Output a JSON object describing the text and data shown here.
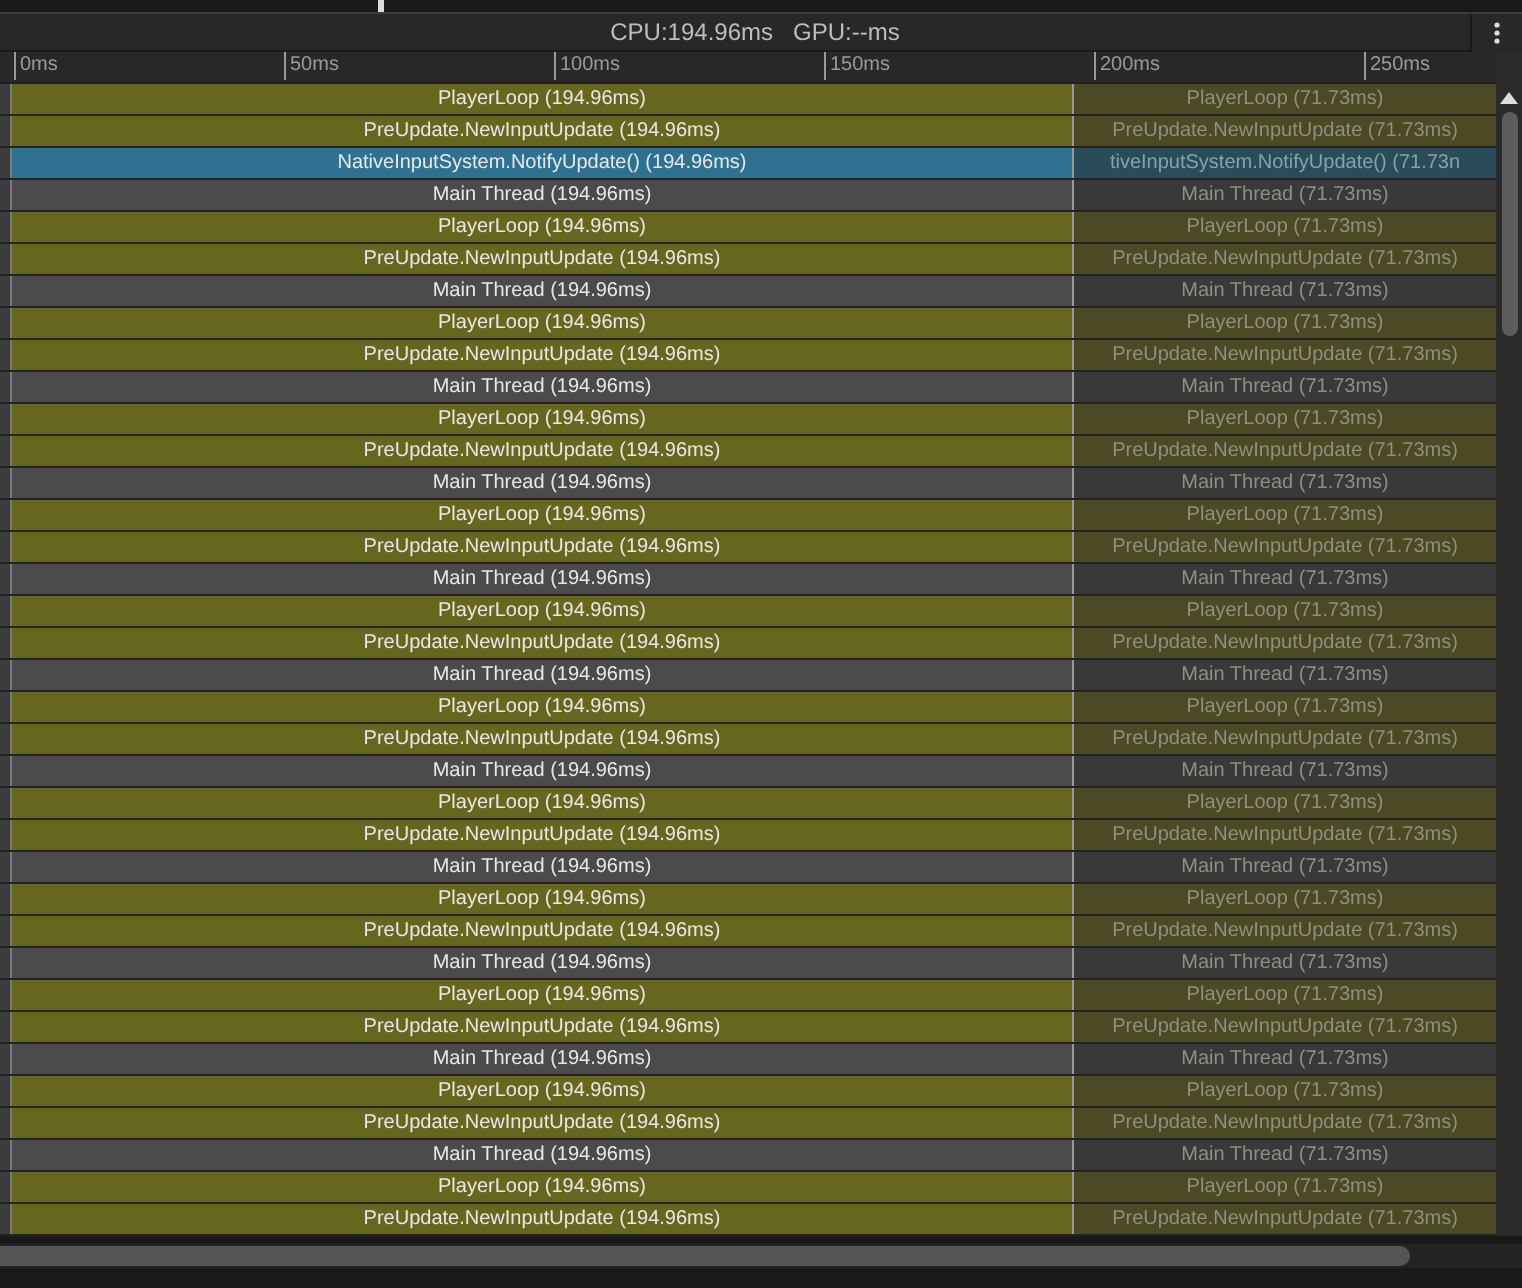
{
  "toolbar": {
    "stats": "CPU:194.96ms   GPU:--ms"
  },
  "ruler": {
    "ticks": [
      "0ms",
      "50ms",
      "100ms",
      "150ms",
      "200ms",
      "250ms"
    ]
  },
  "rows": [
    {
      "kind": "loop",
      "label": "PlayerLoop (194.96ms)",
      "next_label": "PlayerLoop (71.73ms)"
    },
    {
      "kind": "loop",
      "label": "PreUpdate.NewInputUpdate (194.96ms)",
      "next_label": "PreUpdate.NewInputUpdate (71.73ms)"
    },
    {
      "kind": "input",
      "label": "NativeInputSystem.NotifyUpdate() (194.96ms)",
      "next_label": "tiveInputSystem.NotifyUpdate() (71.73n"
    },
    {
      "kind": "thread",
      "label": "Main Thread (194.96ms)",
      "next_label": "Main Thread (71.73ms)"
    },
    {
      "kind": "loop",
      "label": "PlayerLoop (194.96ms)",
      "next_label": "PlayerLoop (71.73ms)"
    },
    {
      "kind": "loop",
      "label": "PreUpdate.NewInputUpdate (194.96ms)",
      "next_label": "PreUpdate.NewInputUpdate (71.73ms)"
    },
    {
      "kind": "thread",
      "label": "Main Thread (194.96ms)",
      "next_label": "Main Thread (71.73ms)"
    },
    {
      "kind": "loop",
      "label": "PlayerLoop (194.96ms)",
      "next_label": "PlayerLoop (71.73ms)"
    },
    {
      "kind": "loop",
      "label": "PreUpdate.NewInputUpdate (194.96ms)",
      "next_label": "PreUpdate.NewInputUpdate (71.73ms)"
    },
    {
      "kind": "thread",
      "label": "Main Thread (194.96ms)",
      "next_label": "Main Thread (71.73ms)"
    },
    {
      "kind": "loop",
      "label": "PlayerLoop (194.96ms)",
      "next_label": "PlayerLoop (71.73ms)"
    },
    {
      "kind": "loop",
      "label": "PreUpdate.NewInputUpdate (194.96ms)",
      "next_label": "PreUpdate.NewInputUpdate (71.73ms)"
    },
    {
      "kind": "thread",
      "label": "Main Thread (194.96ms)",
      "next_label": "Main Thread (71.73ms)"
    },
    {
      "kind": "loop",
      "label": "PlayerLoop (194.96ms)",
      "next_label": "PlayerLoop (71.73ms)"
    },
    {
      "kind": "loop",
      "label": "PreUpdate.NewInputUpdate (194.96ms)",
      "next_label": "PreUpdate.NewInputUpdate (71.73ms)"
    },
    {
      "kind": "thread",
      "label": "Main Thread (194.96ms)",
      "next_label": "Main Thread (71.73ms)"
    },
    {
      "kind": "loop",
      "label": "PlayerLoop (194.96ms)",
      "next_label": "PlayerLoop (71.73ms)"
    },
    {
      "kind": "loop",
      "label": "PreUpdate.NewInputUpdate (194.96ms)",
      "next_label": "PreUpdate.NewInputUpdate (71.73ms)"
    },
    {
      "kind": "thread",
      "label": "Main Thread (194.96ms)",
      "next_label": "Main Thread (71.73ms)"
    },
    {
      "kind": "loop",
      "label": "PlayerLoop (194.96ms)",
      "next_label": "PlayerLoop (71.73ms)"
    },
    {
      "kind": "loop",
      "label": "PreUpdate.NewInputUpdate (194.96ms)",
      "next_label": "PreUpdate.NewInputUpdate (71.73ms)"
    },
    {
      "kind": "thread",
      "label": "Main Thread (194.96ms)",
      "next_label": "Main Thread (71.73ms)"
    },
    {
      "kind": "loop",
      "label": "PlayerLoop (194.96ms)",
      "next_label": "PlayerLoop (71.73ms)"
    },
    {
      "kind": "loop",
      "label": "PreUpdate.NewInputUpdate (194.96ms)",
      "next_label": "PreUpdate.NewInputUpdate (71.73ms)"
    },
    {
      "kind": "thread",
      "label": "Main Thread (194.96ms)",
      "next_label": "Main Thread (71.73ms)"
    },
    {
      "kind": "loop",
      "label": "PlayerLoop (194.96ms)",
      "next_label": "PlayerLoop (71.73ms)"
    },
    {
      "kind": "loop",
      "label": "PreUpdate.NewInputUpdate (194.96ms)",
      "next_label": "PreUpdate.NewInputUpdate (71.73ms)"
    },
    {
      "kind": "thread",
      "label": "Main Thread (194.96ms)",
      "next_label": "Main Thread (71.73ms)"
    },
    {
      "kind": "loop",
      "label": "PlayerLoop (194.96ms)",
      "next_label": "PlayerLoop (71.73ms)"
    },
    {
      "kind": "loop",
      "label": "PreUpdate.NewInputUpdate (194.96ms)",
      "next_label": "PreUpdate.NewInputUpdate (71.73ms)"
    },
    {
      "kind": "thread",
      "label": "Main Thread (194.96ms)",
      "next_label": "Main Thread (71.73ms)"
    },
    {
      "kind": "loop",
      "label": "PlayerLoop (194.96ms)",
      "next_label": "PlayerLoop (71.73ms)"
    },
    {
      "kind": "loop",
      "label": "PreUpdate.NewInputUpdate (194.96ms)",
      "next_label": "PreUpdate.NewInputUpdate (71.73ms)"
    },
    {
      "kind": "thread",
      "label": "Main Thread (194.96ms)",
      "next_label": "Main Thread (71.73ms)"
    },
    {
      "kind": "loop",
      "label": "PlayerLoop (194.96ms)",
      "next_label": "PlayerLoop (71.73ms)"
    },
    {
      "kind": "loop",
      "label": "PreUpdate.NewInputUpdate (194.96ms)",
      "next_label": "PreUpdate.NewInputUpdate (71.73ms)"
    }
  ]
}
